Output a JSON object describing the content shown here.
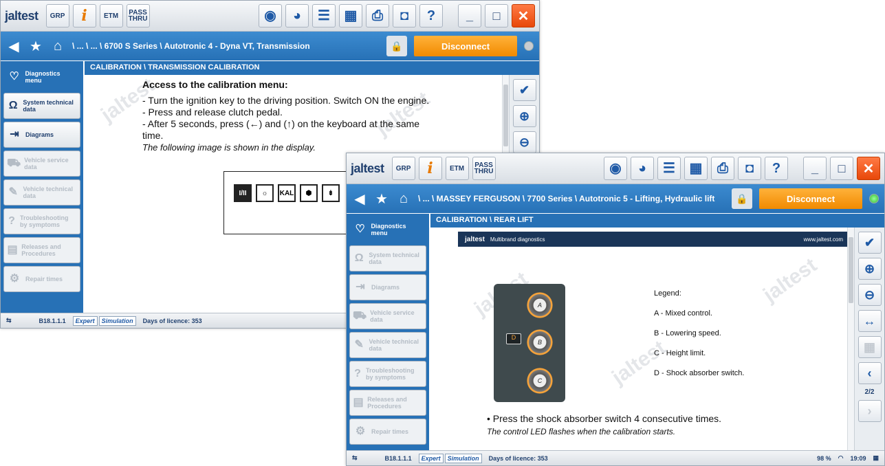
{
  "window1": {
    "toolbar": {
      "logo": "jaltest",
      "grp": "GRP",
      "info": "i",
      "etm": "ETM",
      "pass_thru_1": "PASS",
      "pass_thru_2": "THRU"
    },
    "breadcrumb": "\\ ... \\ ... \\ 6700 S Series \\ Autotronic 4 - Dyna VT, Transmission",
    "disconnect": "Disconnect",
    "sidebar": [
      {
        "icon": "stethoscope-icon",
        "label": "Diagnostics menu",
        "state": "active"
      },
      {
        "icon": "omega-icon",
        "label": "System technical data",
        "state": "normal"
      },
      {
        "icon": "diagram-icon",
        "label": "Diagrams",
        "state": "normal"
      },
      {
        "icon": "vehicle-service-icon",
        "label": "Vehicle service data",
        "state": "disabled"
      },
      {
        "icon": "vehicle-technical-icon",
        "label": "Vehicle technical data",
        "state": "disabled"
      },
      {
        "icon": "troubleshooting-icon",
        "label": "Troubleshooting by symptoms",
        "state": "disabled"
      },
      {
        "icon": "releases-icon",
        "label": "Releases and Procedures",
        "state": "disabled"
      },
      {
        "icon": "repair-times-icon",
        "label": "Repair times",
        "state": "disabled"
      }
    ],
    "content_header": "CALIBRATION \\ TRANSMISSION CALIBRATION",
    "doc": {
      "heading": "Access to the calibration menu:",
      "lines": [
        "- Turn the ignition key to the driving position. Switch ON the engine.",
        "- Press and release clutch pedal.",
        "- After 5 seconds, press (←) and (↑) on the keyboard at the same",
        "time."
      ],
      "note": "The following image is shown in the display.",
      "display_icons": [
        "I/II",
        "☼",
        "KAL",
        "⬢",
        "⇟"
      ]
    },
    "status": {
      "version": "B18.1.1.1",
      "mode1": "Expert",
      "mode2": "Simulation",
      "licence": "Days of licence: 353"
    }
  },
  "window2": {
    "toolbar": {
      "logo": "jaltest",
      "grp": "GRP",
      "info": "i",
      "etm": "ETM",
      "pass_thru_1": "PASS",
      "pass_thru_2": "THRU"
    },
    "breadcrumb": "\\ ... \\ MASSEY FERGUSON \\ 7700 Series \\ Autotronic 5 - Lifting, Hydraulic lift",
    "disconnect": "Disconnect",
    "sidebar": [
      {
        "icon": "stethoscope-icon",
        "label": "Diagnostics menu",
        "state": "active"
      },
      {
        "icon": "omega-icon",
        "label": "System technical data",
        "state": "disabled"
      },
      {
        "icon": "diagram-icon",
        "label": "Diagrams",
        "state": "disabled"
      },
      {
        "icon": "vehicle-service-icon",
        "label": "Vehicle service data",
        "state": "disabled"
      },
      {
        "icon": "vehicle-technical-icon",
        "label": "Vehicle technical data",
        "state": "disabled"
      },
      {
        "icon": "troubleshooting-icon",
        "label": "Troubleshooting by symptoms",
        "state": "disabled"
      },
      {
        "icon": "releases-icon",
        "label": "Releases and Procedures",
        "state": "disabled"
      },
      {
        "icon": "repair-times-icon",
        "label": "Repair times",
        "state": "disabled"
      }
    ],
    "content_header": "CALIBRATION \\ REAR LIFT",
    "doc": {
      "band_logo": "jaltest",
      "band_sub": "Multibrand diagnostics",
      "band_url": "www.jaltest.com",
      "knobs": [
        "A",
        "B",
        "C"
      ],
      "led_label": "D",
      "legend": [
        "Legend:",
        "A - Mixed control.",
        "B - Lowering speed.",
        "C - Height limit.",
        "D - Shock absorber switch."
      ],
      "instruction": "• Press the shock absorber switch 4 consecutive times.",
      "note": "The control LED flashes when the calibration starts."
    },
    "page_indicator": "2/2",
    "status": {
      "version": "B18.1.1.1",
      "mode1": "Expert",
      "mode2": "Simulation",
      "licence": "Days of licence: 353",
      "battery": "98 %",
      "time": "19:09"
    }
  },
  "colors": {
    "accent": "#2771b6",
    "disconnect": "#f18a00",
    "close": "#e8480a"
  }
}
